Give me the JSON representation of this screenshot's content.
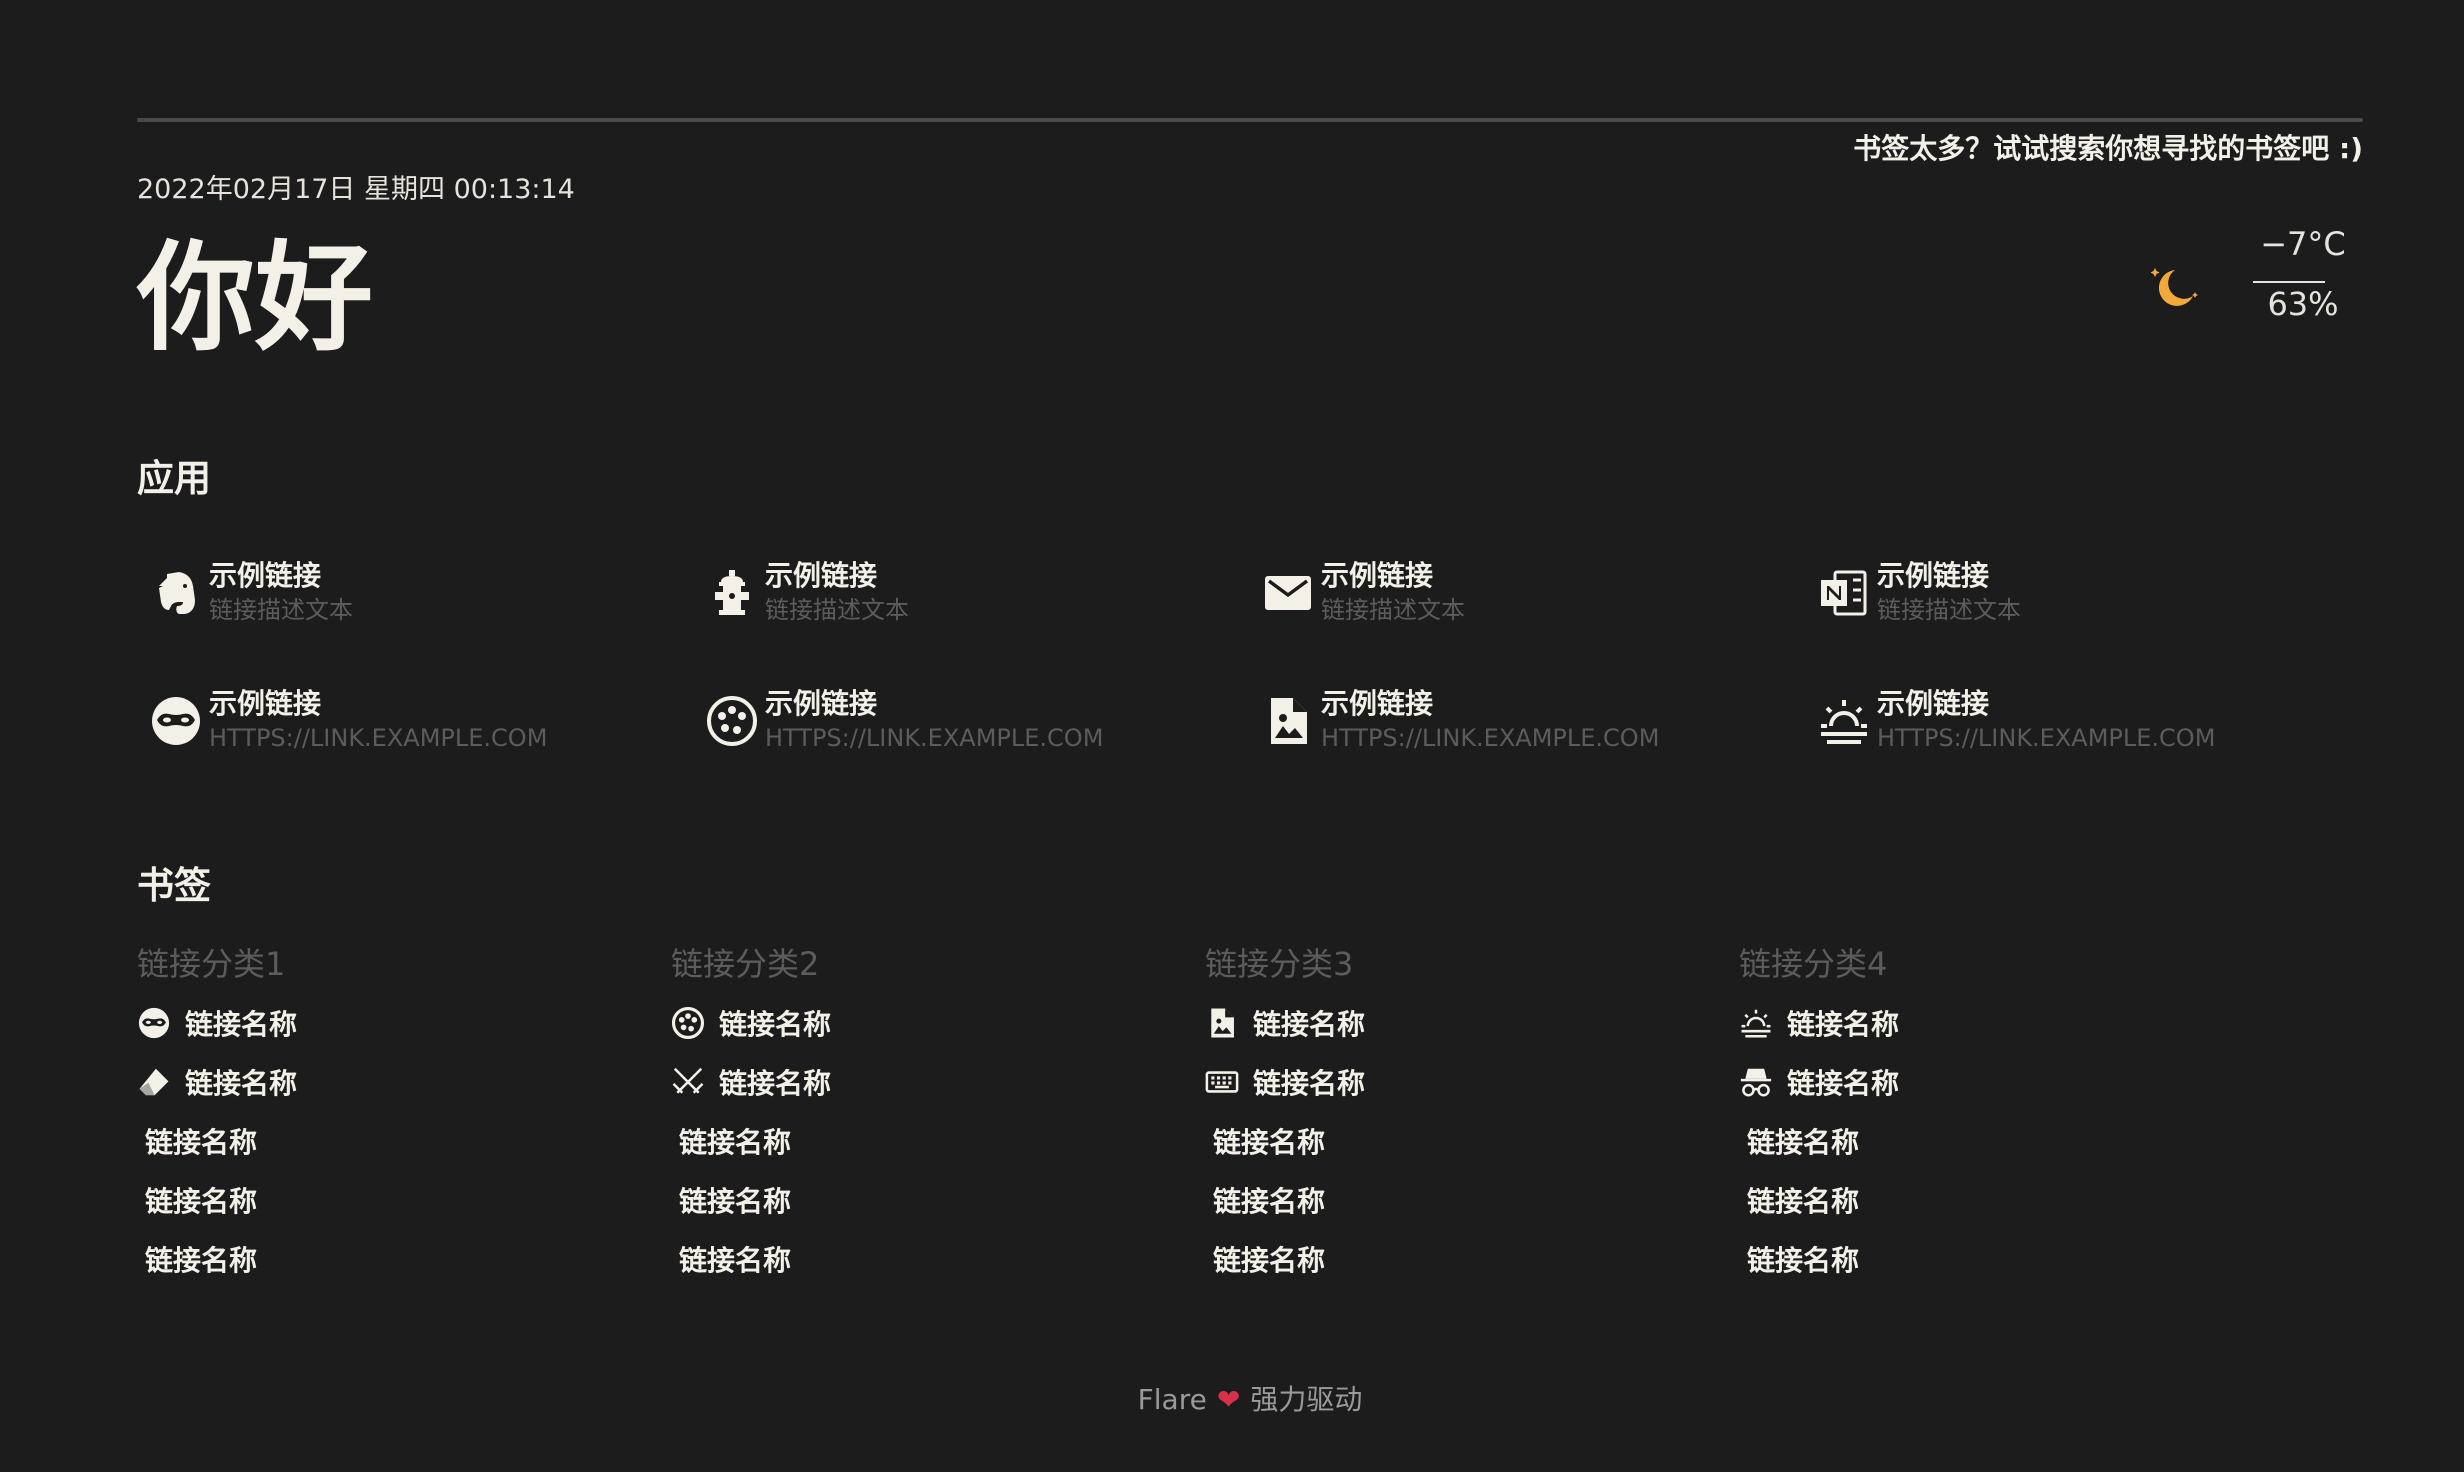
{
  "search": {
    "hint": "书签太多？试试搜索你想寻找的书签吧 :)"
  },
  "header": {
    "datetime": "2022年02月17日 星期四 00:13:14",
    "greeting": "你好"
  },
  "weather": {
    "icon": "moon-icon",
    "temperature": "−7°C",
    "humidity": "63%",
    "icon_color": "#f2a93b"
  },
  "apps": {
    "title": "应用",
    "items": [
      {
        "name": "示例链接",
        "desc": "链接描述文本",
        "icon": "evernote-icon"
      },
      {
        "name": "示例链接",
        "desc": "链接描述文本",
        "icon": "fire-hydrant-icon"
      },
      {
        "name": "示例链接",
        "desc": "链接描述文本",
        "icon": "email-icon"
      },
      {
        "name": "示例链接",
        "desc": "链接描述文本",
        "icon": "onenote-icon"
      },
      {
        "name": "示例链接",
        "desc": "HTTPS://LINK.EXAMPLE.COM",
        "icon": "domino-mask-icon"
      },
      {
        "name": "示例链接",
        "desc": "HTTPS://LINK.EXAMPLE.COM",
        "icon": "palette-icon"
      },
      {
        "name": "示例链接",
        "desc": "HTTPS://LINK.EXAMPLE.COM",
        "icon": "file-image-icon"
      },
      {
        "name": "示例链接",
        "desc": "HTTPS://LINK.EXAMPLE.COM",
        "icon": "weather-sunset-icon"
      }
    ]
  },
  "bookmarks": {
    "title": "书签",
    "categories": [
      {
        "name": "链接分类1",
        "items": [
          {
            "label": "链接名称",
            "icon": "domino-mask-icon"
          },
          {
            "label": "链接名称",
            "icon": "eraser-icon"
          },
          {
            "label": "链接名称",
            "icon": ""
          },
          {
            "label": "链接名称",
            "icon": ""
          },
          {
            "label": "链接名称",
            "icon": ""
          }
        ]
      },
      {
        "name": "链接分类2",
        "items": [
          {
            "label": "链接名称",
            "icon": "palette-icon"
          },
          {
            "label": "链接名称",
            "icon": "fencing-icon"
          },
          {
            "label": "链接名称",
            "icon": ""
          },
          {
            "label": "链接名称",
            "icon": ""
          },
          {
            "label": "链接名称",
            "icon": ""
          }
        ]
      },
      {
        "name": "链接分类3",
        "items": [
          {
            "label": "链接名称",
            "icon": "file-image-icon"
          },
          {
            "label": "链接名称",
            "icon": "keyboard-icon"
          },
          {
            "label": "链接名称",
            "icon": ""
          },
          {
            "label": "链接名称",
            "icon": ""
          },
          {
            "label": "链接名称",
            "icon": ""
          }
        ]
      },
      {
        "name": "链接分类4",
        "items": [
          {
            "label": "链接名称",
            "icon": "weather-sunset-icon"
          },
          {
            "label": "链接名称",
            "icon": "incognito-icon"
          },
          {
            "label": "链接名称",
            "icon": ""
          },
          {
            "label": "链接名称",
            "icon": ""
          },
          {
            "label": "链接名称",
            "icon": ""
          }
        ]
      }
    ]
  },
  "footer": {
    "brand": "Flare",
    "heart": "❤",
    "suffix": "强力驱动"
  },
  "colors": {
    "background": "#1c1c1c",
    "text": "#f3f0e8",
    "muted": "#5c5c5c",
    "accent": "#f2a93b",
    "heart": "#d9304a"
  }
}
